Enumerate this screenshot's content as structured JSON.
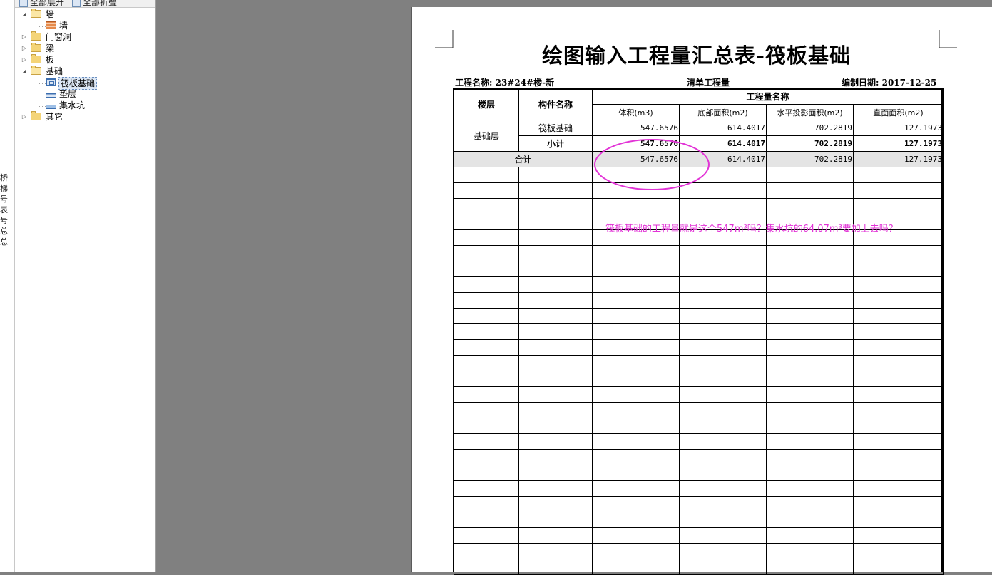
{
  "left_strip": {
    "vertical_text": "桥梯号表号总总"
  },
  "tree": {
    "toolbar": {
      "expand_all": "全部展开",
      "collapse_all": "全部折叠"
    },
    "nodes": {
      "wall_group": "墙",
      "wall_item": "墙",
      "door_window": "门窗洞",
      "beam": "梁",
      "slab": "板",
      "foundation": "基础",
      "raft": "筏板基础",
      "cushion": "垫层",
      "sump": "集水坑",
      "other": "其它"
    }
  },
  "report": {
    "title": "绘图输入工程量汇总表-筏板基础",
    "project_label": "工程名称: 23#24#楼-新",
    "list_type": "清单工程量",
    "date_label": "编制日期: 2017-12-25",
    "headers": {
      "floor": "楼层",
      "component": "构件名称",
      "qty_group": "工程量名称",
      "volume": "体积(m3)",
      "bottom_area": "底部面积(m2)",
      "horiz_proj_area": "水平投影面积(m2)",
      "side_area": "直面面积(m2)"
    },
    "rows": {
      "floor_name": "基础层",
      "item": {
        "name": "筏板基础",
        "volume": "547.6576",
        "bottom_area": "614.4017",
        "horiz_proj_area": "702.2819",
        "side_area": "127.1973"
      },
      "subtotal": {
        "name": "小计",
        "volume": "547.6576",
        "bottom_area": "614.4017",
        "horiz_proj_area": "702.2819",
        "side_area": "127.1973"
      },
      "total": {
        "name": "合计",
        "volume": "547.6576",
        "bottom_area": "614.4017",
        "horiz_proj_area": "702.2819",
        "side_area": "127.1973"
      }
    },
    "empty_rows": 26
  },
  "annotation": {
    "text": "筏板基础的工程量就是这个547m³吗？集水坑的64.07m³要加上去吗？",
    "color": "#e233d6"
  }
}
